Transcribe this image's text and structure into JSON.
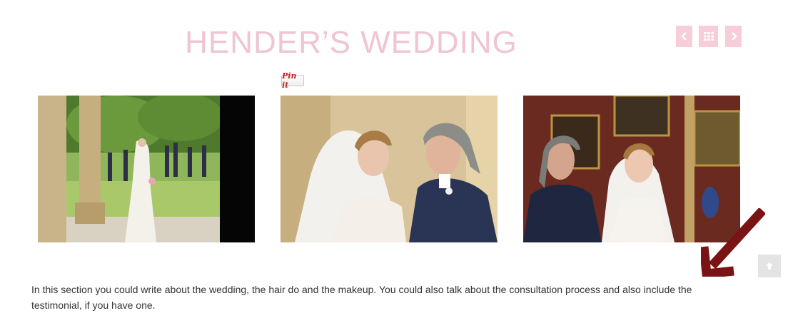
{
  "gallery": {
    "title": "HENDER’S WEDDING",
    "nav": {
      "prev_icon": "chevron-left-icon",
      "grid_icon": "grid-icon",
      "next_icon": "chevron-right-icon"
    },
    "pin_label": "Pin it",
    "photos": [
      {
        "name": "bride-on-terrace-photo"
      },
      {
        "name": "bride-and-groom-smiling-photo"
      },
      {
        "name": "couple-in-library-photo"
      }
    ],
    "description": "In this section you could write about the wedding, the hair do and the makeup. You could also talk about the consultation process and also include the testimonial, if you have one."
  },
  "annotation": {
    "arrow_color": "#7a1313",
    "icon": "annotation-arrow-icon"
  },
  "scroll_top": {
    "icon": "arrow-up-icon"
  },
  "colors": {
    "title": "#f0c4d2",
    "nav_button": "#f6cdd8",
    "text": "#333333",
    "pinterest_red": "#cb2027"
  }
}
